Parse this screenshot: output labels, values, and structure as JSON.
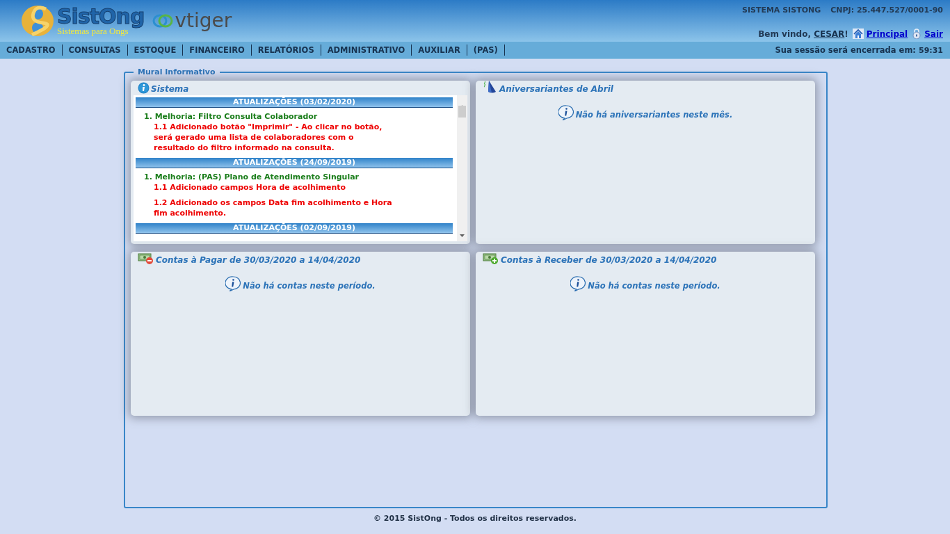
{
  "header": {
    "brand": "SistOng",
    "tagline": "Sistemas para Ongs",
    "partner": "vtiger",
    "system_name": "SISTEMA SISTONG",
    "cnpj": "CNPJ: 25.447.527/0001-90",
    "welcome": {
      "prefix": "Bem vindo, ",
      "user": "CESAR",
      "suffix": "!"
    },
    "links": [
      {
        "kind": "home",
        "label": "Principal"
      },
      {
        "kind": "lock",
        "label": "Sair"
      }
    ]
  },
  "menu": {
    "items": [
      "CADASTRO",
      "CONSULTAS",
      "ESTOQUE",
      "FINANCEIRO",
      "RELATÓRIOS",
      "ADMINISTRATIVO",
      "AUXILIAR",
      "(PAS)"
    ],
    "session_label": "Sua sessão será encerrada em:",
    "session_time": "59:31"
  },
  "mural": {
    "title": "Mural Informativo",
    "panels": [
      {
        "kind": "updates",
        "title": "Sistema",
        "sections": [
          {
            "heading": "ATUALIZAÇÕES (03/02/2020)",
            "items": [
              {
                "title": "1. Melhoria: Filtro Consulta Colaborador",
                "details": [
                  "1.1 Adicionado botão \"Imprimir\" - Ao clicar no botão, será gerado uma lista de colaboradores com o resultado do filtro informado na consulta."
                ]
              }
            ]
          },
          {
            "heading": "ATUALIZAÇÕES (24/09/2019)",
            "items": [
              {
                "title": "1. Melhoria: (PAS) Plano de Atendimento Singular",
                "details": [
                  "1.1 Adicionado campos Hora de acolhimento",
                  "1.2 Adicionado os campos Data fim acolhimento e Hora fim acolhimento."
                ]
              }
            ]
          },
          {
            "heading": "ATUALIZAÇÕES (02/09/2019)"
          }
        ]
      },
      {
        "kind": "birthdays",
        "title": "Aniversariantes de Abril",
        "message": "Não há aniversariantes neste mês."
      },
      {
        "kind": "payable",
        "title": "Contas à Pagar de 30/03/2020 a 14/04/2020",
        "message": "Não há contas neste período."
      },
      {
        "kind": "receivable",
        "title": "Contas à Receber de 30/03/2020 a 14/04/2020",
        "message": "Não há contas neste período."
      }
    ]
  },
  "footer": "© 2015 SistOng - Todos os direitos reservados."
}
